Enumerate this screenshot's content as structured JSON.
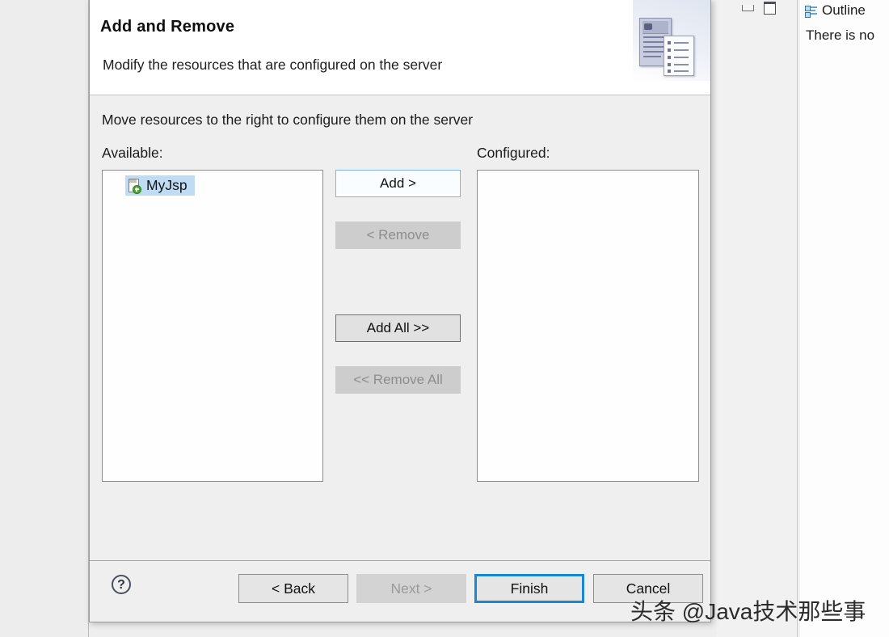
{
  "background": {
    "outline_view": {
      "icon": "outline-tree-icon",
      "title": "Outline",
      "message": "There is no",
      "minimize_icon": "minimize-icon",
      "maximize_icon": "maximize-icon"
    }
  },
  "dialog": {
    "title": "Add and Remove",
    "subtitle": "Modify the resources that are configured on the server",
    "banner_icon": "two-documents-banner-icon",
    "body": {
      "instructions": "Move resources to the right to configure them on the server",
      "available_label": "Available:",
      "configured_label": "Configured:",
      "available_items": [
        {
          "label": "MyJsp",
          "icon": "project-module-icon",
          "selected": true
        }
      ],
      "configured_items": [],
      "transfer_buttons": [
        {
          "label": "Add >",
          "state": "focused"
        },
        {
          "label": "< Remove",
          "state": "disabled"
        },
        {
          "label": "Add All >>",
          "state": "enabled"
        },
        {
          "label": "<< Remove All",
          "state": "disabled"
        }
      ]
    },
    "footer": {
      "help_icon": "help-question-icon",
      "help_glyph": "?",
      "buttons": [
        {
          "label": "< Back",
          "state": "enabled"
        },
        {
          "label": "Next >",
          "state": "disabled"
        },
        {
          "label": "Finish",
          "state": "default"
        },
        {
          "label": "Cancel",
          "state": "enabled"
        }
      ]
    }
  },
  "watermark": "头条 @Java技术那些事",
  "colors": {
    "accent_blue": "#1a87d2",
    "focus_border": "#7eb4e2",
    "selection_blue": "#bfdcf4",
    "dialog_bg": "#f0efef",
    "header_bg": "#ffffff",
    "disabled_text": "#9a9a9a"
  }
}
